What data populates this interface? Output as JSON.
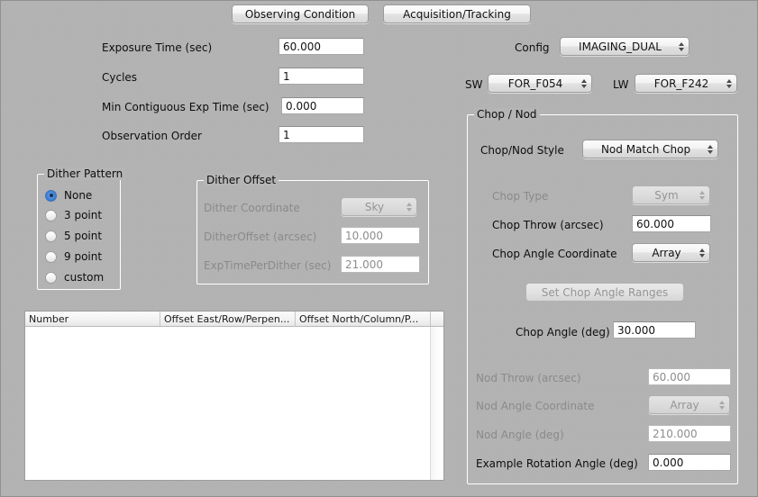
{
  "window": {
    "title": "Observing Condition"
  },
  "tabs": [
    {
      "id": "observing-condition",
      "label": "Observing Condition",
      "selected": true
    },
    {
      "id": "acquisition-tracking",
      "label": "Acquisition/Tracking",
      "selected": false
    }
  ],
  "exposure": {
    "rows": [
      {
        "label": "Exposure Time (sec)",
        "value": "60.000"
      },
      {
        "label": "Cycles",
        "value": "1"
      },
      {
        "label": "Min Contiguous Exp Time (sec)",
        "value": "0.000"
      },
      {
        "label": "Observation Order",
        "value": "1"
      }
    ]
  },
  "config": {
    "label": "Config",
    "value": "IMAGING_DUAL",
    "sw_label": "SW",
    "sw_value": "FOR_F054",
    "lw_label": "LW",
    "lw_value": "FOR_F242"
  },
  "dither_pattern": {
    "title": "Dither Pattern",
    "options": [
      {
        "label": "None",
        "selected": true
      },
      {
        "label": "3 point",
        "selected": false
      },
      {
        "label": "5 point",
        "selected": false
      },
      {
        "label": "9 point",
        "selected": false
      },
      {
        "label": "custom",
        "selected": false
      }
    ]
  },
  "dither_offset": {
    "title": "Dither Offset",
    "coordinate_label": "Dither Coordinate",
    "coordinate_value": "Sky",
    "offset_label": "DitherOffset (arcsec)",
    "offset_value": "10.000",
    "exptime_label": "ExpTimePerDither (sec)",
    "exptime_value": "21.000"
  },
  "offset_table": {
    "columns": [
      "Number",
      "Offset East/Row/Perpen...",
      "Offset North/Column/P..."
    ],
    "rows": []
  },
  "chop_nod": {
    "title": "Chop / Nod",
    "style_label": "Chop/Nod Style",
    "style_value": "Nod Match Chop",
    "chop_type_label": "Chop Type",
    "chop_type_value": "Sym",
    "chop_throw_label": "Chop Throw (arcsec)",
    "chop_throw_value": "60.000",
    "chop_angle_coord_label": "Chop Angle Coordinate",
    "chop_angle_coord_value": "Array",
    "set_ranges_label": "Set Chop Angle Ranges",
    "chop_angle_label": "Chop Angle (deg)",
    "chop_angle_value": "30.000",
    "nod_throw_label": "Nod Throw (arcsec)",
    "nod_throw_value": "60.000",
    "nod_angle_coord_label": "Nod Angle Coordinate",
    "nod_angle_coord_value": "Array",
    "nod_angle_label": "Nod Angle (deg)",
    "nod_angle_value": "210.000",
    "example_rotation_label": "Example Rotation Angle (deg)",
    "example_rotation_value": "0.000"
  },
  "colors": {
    "window_background": "#b5b5b5",
    "field_background": "#ffffff",
    "text": "#0d0d0d",
    "disabled_text": "#8a8a8a",
    "radio_accent": "#3d7fd4",
    "group_border": "#ffffff"
  }
}
